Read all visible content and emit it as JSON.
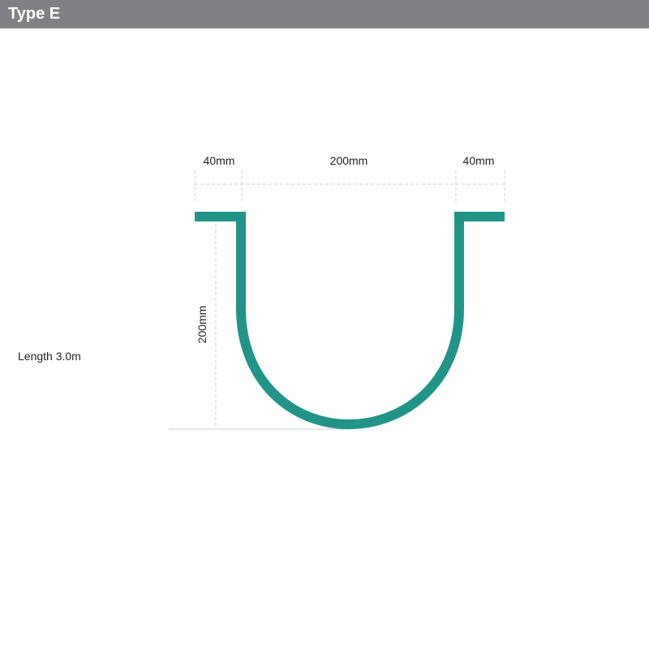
{
  "header": {
    "title": "Type E",
    "background_color": "#808184"
  },
  "diagram": {
    "profile_color": "#21948a",
    "dimension_line_color": "#c9d3da",
    "dimensions": {
      "left_flange": "40mm",
      "channel_width": "200mm",
      "right_flange": "40mm",
      "depth": "200mm"
    },
    "length_note": "Length 3.0m"
  }
}
